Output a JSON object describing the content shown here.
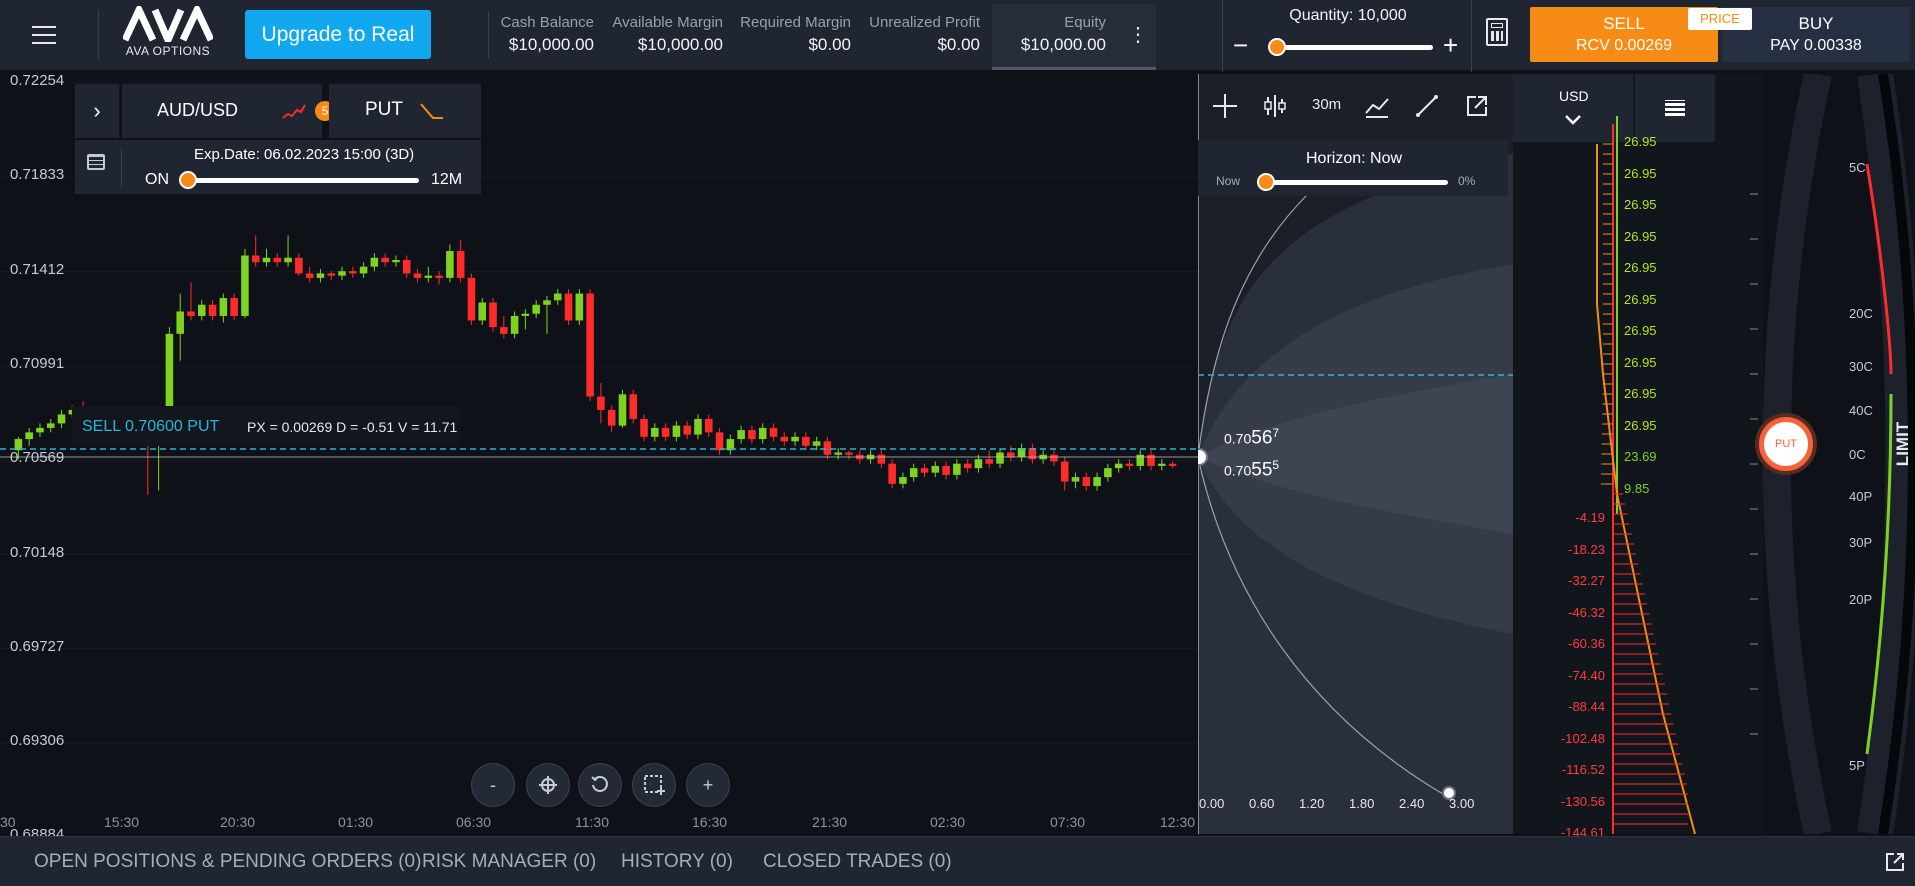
{
  "header": {
    "menu_icon": "hamburger-icon",
    "logo_text": "AVA",
    "logo_sub": "AVA OPTIONS",
    "upgrade_label": "Upgrade to Real",
    "stats": [
      {
        "label": "Cash Balance",
        "value": "$10,000.00"
      },
      {
        "label": "Available Margin",
        "value": "$10,000.00"
      },
      {
        "label": "Required Margin",
        "value": "$0.00"
      },
      {
        "label": "Unrealized Profit",
        "value": "$0.00"
      },
      {
        "label": "Equity",
        "value": "$10,000.00"
      }
    ],
    "more_icon": "vertical-dots-icon",
    "quantity_label": "Quantity: 10,000",
    "quantity_level": 0.05,
    "calculator_icon": "calculator-icon",
    "sell": {
      "label": "SELL",
      "sub": "RCV 0.00269"
    },
    "price_tag": "PRICE",
    "buy": {
      "label": "BUY",
      "sub": "PAY 0.00338"
    }
  },
  "instrument": {
    "symbol": "AUD/USD",
    "badge": "5",
    "option_type": "PUT",
    "exp_date": "Exp.Date: 06.02.2023 15:00 (3D)",
    "slider_left": "ON",
    "slider_right": "12M"
  },
  "trade_line": {
    "side_text": "SELL 0.70600 PUT",
    "info_text": "PX = 0.00269 D = -0.51 V = 11.71"
  },
  "y_axis": [
    "0.72254",
    "0.71833",
    "0.71412",
    "0.70991",
    "0.70569",
    "0.70148",
    "0.69727",
    "0.69306",
    "0.68884"
  ],
  "x_axis": [
    "30",
    "15:30",
    "20:30",
    "01:30",
    "06:30",
    "11:30",
    "16:30",
    "21:30",
    "02:30",
    "07:30",
    "12:30"
  ],
  "zoom_controls": [
    "-",
    "+"
  ],
  "toolbar": {
    "timeframe": "30m"
  },
  "horizon": {
    "label": "Horizon: Now",
    "left": "Now",
    "right": "0%"
  },
  "price_marks": {
    "upper_pre": "0.70",
    "upper_big": "56",
    "upper_sup": "7",
    "lower_pre": "0.70",
    "lower_big": "55",
    "lower_sup": "5"
  },
  "prob_axis": [
    "0.00",
    "0.60",
    "1.20",
    "1.80",
    "2.40",
    "3.00"
  ],
  "ladder": {
    "currency": "USD",
    "green_values": [
      "26.95",
      "26.95",
      "26.95",
      "26.95",
      "26.95",
      "26.95",
      "26.95",
      "26.95",
      "26.95",
      "26.95",
      "23.69",
      "9.85"
    ],
    "red_values": [
      "-4.19",
      "-18.23",
      "-32.27",
      "-46.32",
      "-60.36",
      "-74.40",
      "-88.44",
      "-102.48",
      "-116.52",
      "-130.56",
      "-144.61"
    ]
  },
  "strike_marks": [
    "5C",
    "20C",
    "30C",
    "40C",
    "0C",
    "40P",
    "30P",
    "20P",
    "5P"
  ],
  "put_knob": "PUT",
  "limit_label": "LIMIT",
  "bottom_tabs": [
    "OPEN POSITIONS & PENDING ORDERS (0)",
    "RISK MANAGER (0)",
    "HISTORY (0)",
    "CLOSED TRADES (0)"
  ],
  "colors": {
    "up": "#7ed321",
    "down": "#ff2b2b",
    "accent": "#f68b16",
    "blue": "#12a8ef",
    "dash": "#27b6d9"
  },
  "chart_data": {
    "type": "candlestick",
    "ylim": [
      0.68884,
      0.72254
    ],
    "candles": [
      [
        0.706,
        0.7065,
        0.7056,
        0.7066
      ],
      [
        0.7065,
        0.7068,
        0.7062,
        0.707
      ],
      [
        0.7068,
        0.707,
        0.7066,
        0.7072
      ],
      [
        0.707,
        0.7072,
        0.7068,
        0.7074
      ],
      [
        0.7072,
        0.7076,
        0.707,
        0.7078
      ],
      [
        0.7076,
        0.7078,
        0.7074,
        0.708
      ],
      [
        0.7078,
        0.7076,
        0.7074,
        0.7082
      ],
      [
        0.7076,
        0.7077,
        0.7074,
        0.7079
      ],
      [
        0.7077,
        0.7074,
        0.7072,
        0.7079
      ],
      [
        0.7074,
        0.707,
        0.7069,
        0.7076
      ],
      [
        0.707,
        0.7072,
        0.7069,
        0.7074
      ],
      [
        0.7072,
        0.707,
        0.7068,
        0.7073
      ],
      [
        0.707,
        0.7069,
        0.704,
        0.7072
      ],
      [
        0.7069,
        0.707,
        0.7042,
        0.7072
      ],
      [
        0.707,
        0.7112,
        0.7068,
        0.7115
      ],
      [
        0.7112,
        0.7122,
        0.71,
        0.713
      ],
      [
        0.7122,
        0.712,
        0.7118,
        0.7135
      ],
      [
        0.712,
        0.7125,
        0.7118,
        0.7127
      ],
      [
        0.7125,
        0.712,
        0.7118,
        0.7127
      ],
      [
        0.712,
        0.7128,
        0.7117,
        0.713
      ],
      [
        0.7128,
        0.712,
        0.7118,
        0.713
      ],
      [
        0.712,
        0.7147,
        0.7119,
        0.715
      ],
      [
        0.7147,
        0.7144,
        0.7142,
        0.7156
      ],
      [
        0.7144,
        0.7146,
        0.7142,
        0.715
      ],
      [
        0.7146,
        0.7144,
        0.7142,
        0.7148
      ],
      [
        0.7144,
        0.7146,
        0.7142,
        0.7156
      ],
      [
        0.7146,
        0.7139,
        0.7138,
        0.7148
      ],
      [
        0.7139,
        0.7137,
        0.7135,
        0.7142
      ],
      [
        0.7137,
        0.7139,
        0.7135,
        0.7141
      ],
      [
        0.7139,
        0.7138,
        0.7136,
        0.714
      ],
      [
        0.7138,
        0.714,
        0.7136,
        0.7142
      ],
      [
        0.714,
        0.7139,
        0.7137,
        0.7142
      ],
      [
        0.7139,
        0.7142,
        0.7137,
        0.7144
      ],
      [
        0.7142,
        0.7146,
        0.714,
        0.7148
      ],
      [
        0.7146,
        0.7144,
        0.7142,
        0.7148
      ],
      [
        0.7144,
        0.7145,
        0.7142,
        0.7147
      ],
      [
        0.7145,
        0.7139,
        0.7137,
        0.7147
      ],
      [
        0.7139,
        0.7137,
        0.7135,
        0.7141
      ],
      [
        0.7137,
        0.7138,
        0.7135,
        0.7142
      ],
      [
        0.7138,
        0.7137,
        0.7134,
        0.714
      ],
      [
        0.7137,
        0.7149,
        0.7135,
        0.7152
      ],
      [
        0.7149,
        0.7137,
        0.7135,
        0.7154
      ],
      [
        0.7137,
        0.7118,
        0.7116,
        0.7139
      ],
      [
        0.7118,
        0.7126,
        0.7116,
        0.7128
      ],
      [
        0.7126,
        0.7115,
        0.7113,
        0.7128
      ],
      [
        0.7115,
        0.7112,
        0.711,
        0.712
      ],
      [
        0.7112,
        0.712,
        0.711,
        0.7122
      ],
      [
        0.712,
        0.7121,
        0.7114,
        0.7123
      ],
      [
        0.7121,
        0.7125,
        0.7119,
        0.7127
      ],
      [
        0.7125,
        0.7127,
        0.7112,
        0.7129
      ],
      [
        0.7127,
        0.713,
        0.7125,
        0.7132
      ],
      [
        0.713,
        0.7118,
        0.7116,
        0.7132
      ],
      [
        0.7118,
        0.713,
        0.7116,
        0.7132
      ],
      [
        0.713,
        0.7084,
        0.7082,
        0.7132
      ],
      [
        0.7084,
        0.7078,
        0.7072,
        0.709
      ],
      [
        0.7078,
        0.7071,
        0.7068,
        0.708
      ],
      [
        0.7071,
        0.7085,
        0.707,
        0.7087
      ],
      [
        0.7085,
        0.7074,
        0.7072,
        0.7087
      ],
      [
        0.7074,
        0.7066,
        0.7064,
        0.7076
      ],
      [
        0.7066,
        0.707,
        0.7064,
        0.7072
      ],
      [
        0.707,
        0.7066,
        0.7064,
        0.7072
      ],
      [
        0.7066,
        0.7071,
        0.7064,
        0.7073
      ],
      [
        0.7071,
        0.7067,
        0.7065,
        0.7073
      ],
      [
        0.7067,
        0.7074,
        0.7065,
        0.7076
      ],
      [
        0.7074,
        0.7068,
        0.7066,
        0.7076
      ],
      [
        0.7068,
        0.706,
        0.7058,
        0.707
      ],
      [
        0.706,
        0.7065,
        0.7058,
        0.7067
      ],
      [
        0.7065,
        0.7069,
        0.7063,
        0.7071
      ],
      [
        0.7069,
        0.7065,
        0.7063,
        0.7071
      ],
      [
        0.7065,
        0.707,
        0.7063,
        0.7072
      ],
      [
        0.707,
        0.7066,
        0.7064,
        0.7072
      ],
      [
        0.7066,
        0.7064,
        0.7062,
        0.7068
      ],
      [
        0.7064,
        0.7066,
        0.7062,
        0.7068
      ],
      [
        0.7066,
        0.7062,
        0.706,
        0.7068
      ],
      [
        0.7062,
        0.7064,
        0.706,
        0.7066
      ],
      [
        0.7064,
        0.7058,
        0.7056,
        0.7066
      ],
      [
        0.7058,
        0.7059,
        0.7056,
        0.7061
      ],
      [
        0.7059,
        0.7058,
        0.7056,
        0.706
      ],
      [
        0.7058,
        0.7056,
        0.7054,
        0.706
      ],
      [
        0.7056,
        0.7058,
        0.7054,
        0.706
      ],
      [
        0.7058,
        0.7054,
        0.7052,
        0.706
      ],
      [
        0.7054,
        0.7045,
        0.7043,
        0.7056
      ],
      [
        0.7045,
        0.7048,
        0.7043,
        0.705
      ],
      [
        0.7048,
        0.7052,
        0.7046,
        0.7054
      ],
      [
        0.7052,
        0.705,
        0.7048,
        0.7054
      ],
      [
        0.705,
        0.7053,
        0.7048,
        0.7055
      ],
      [
        0.7053,
        0.7049,
        0.7047,
        0.7055
      ],
      [
        0.7049,
        0.7054,
        0.7047,
        0.7056
      ],
      [
        0.7054,
        0.7052,
        0.705,
        0.7056
      ],
      [
        0.7052,
        0.7056,
        0.705,
        0.7058
      ],
      [
        0.7056,
        0.7054,
        0.7052,
        0.706
      ],
      [
        0.7054,
        0.7059,
        0.7052,
        0.7061
      ],
      [
        0.7059,
        0.7057,
        0.7055,
        0.7062
      ],
      [
        0.7057,
        0.7061,
        0.7055,
        0.7063
      ],
      [
        0.7061,
        0.7056,
        0.7054,
        0.7063
      ],
      [
        0.7056,
        0.7058,
        0.7054,
        0.706
      ],
      [
        0.7058,
        0.7055,
        0.7053,
        0.706
      ],
      [
        0.7055,
        0.7046,
        0.7042,
        0.7057
      ],
      [
        0.7046,
        0.7048,
        0.7043,
        0.705
      ],
      [
        0.7048,
        0.7044,
        0.7042,
        0.705
      ],
      [
        0.7044,
        0.7048,
        0.7042,
        0.705
      ],
      [
        0.7048,
        0.7052,
        0.7046,
        0.7054
      ],
      [
        0.7052,
        0.7054,
        0.705,
        0.7056
      ],
      [
        0.7054,
        0.7053,
        0.7051,
        0.7056
      ],
      [
        0.7053,
        0.7058,
        0.7051,
        0.706
      ],
      [
        0.7058,
        0.7053,
        0.7051,
        0.706
      ],
      [
        0.7053,
        0.7054,
        0.7051,
        0.7056
      ],
      [
        0.7054,
        0.7053,
        0.7052,
        0.7055
      ]
    ]
  }
}
